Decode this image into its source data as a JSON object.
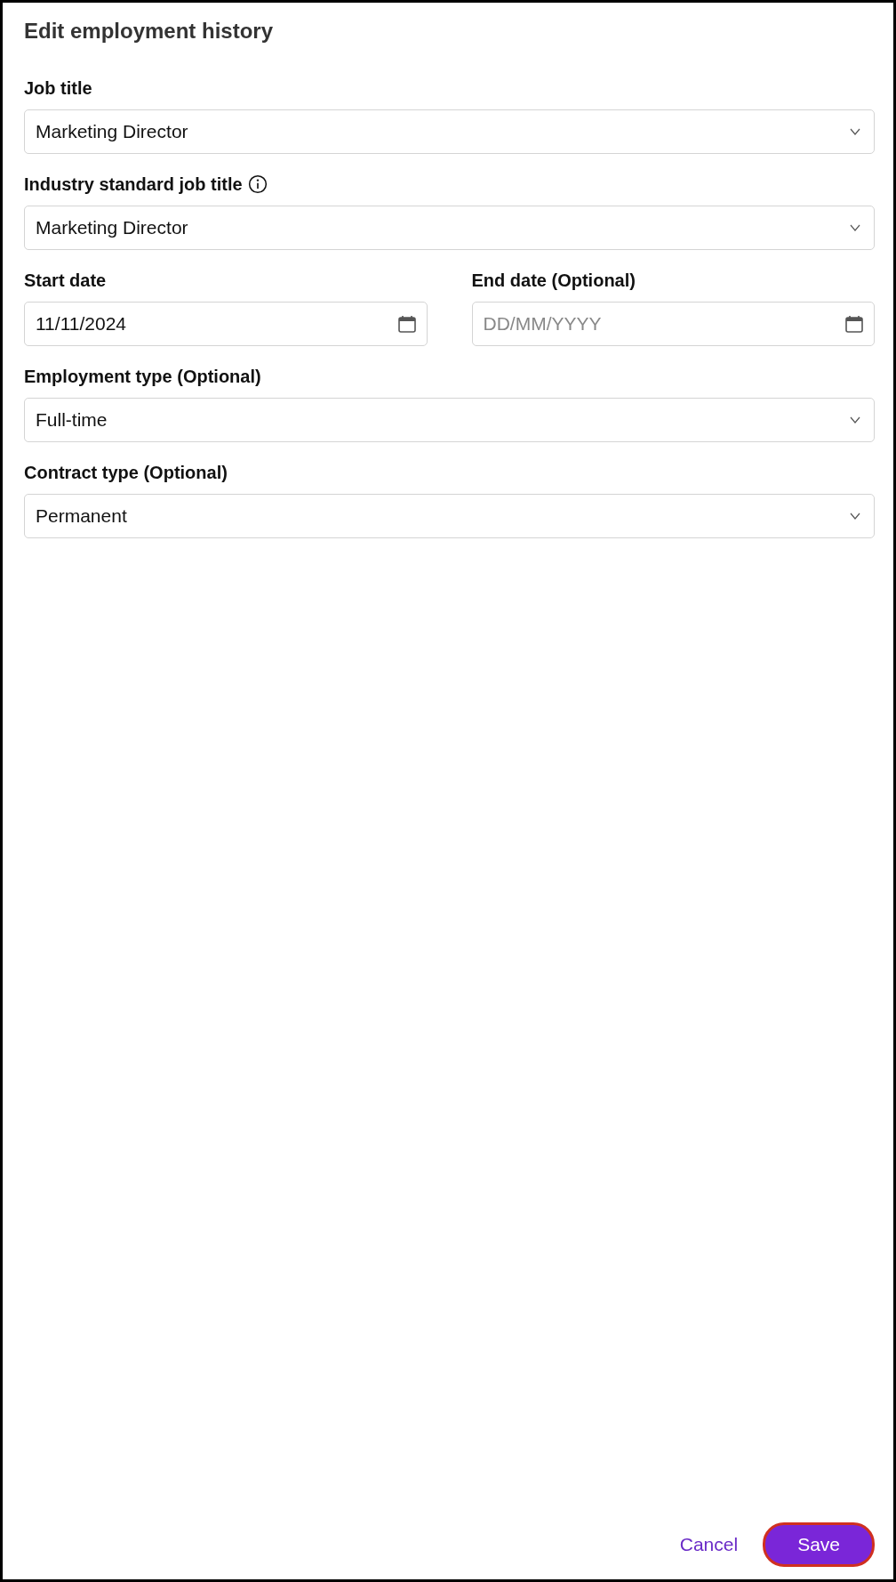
{
  "title": "Edit employment history",
  "rows": [
    {
      "fields": [
        {
          "kind": "select",
          "label": "Job title",
          "value": "Marketing Director"
        }
      ]
    },
    {
      "fields": [
        {
          "kind": "select",
          "label": "Industry standard job title",
          "info": true,
          "value": "Marketing Director"
        }
      ]
    },
    {
      "fields": [
        {
          "kind": "date",
          "label": "Start date",
          "value": "11/11/2024"
        },
        {
          "kind": "date",
          "label": "End date (Optional)",
          "placeholder": "DD/MM/YYYY"
        }
      ]
    },
    {
      "fields": [
        {
          "kind": "select",
          "label": "Employment type (Optional)",
          "value": "Full-time"
        }
      ]
    },
    {
      "fields": [
        {
          "kind": "select",
          "label": "Contract type (Optional)",
          "value": "Permanent"
        }
      ]
    }
  ],
  "actions": {
    "cancel": "Cancel",
    "save": "Save",
    "save_focused": true
  }
}
